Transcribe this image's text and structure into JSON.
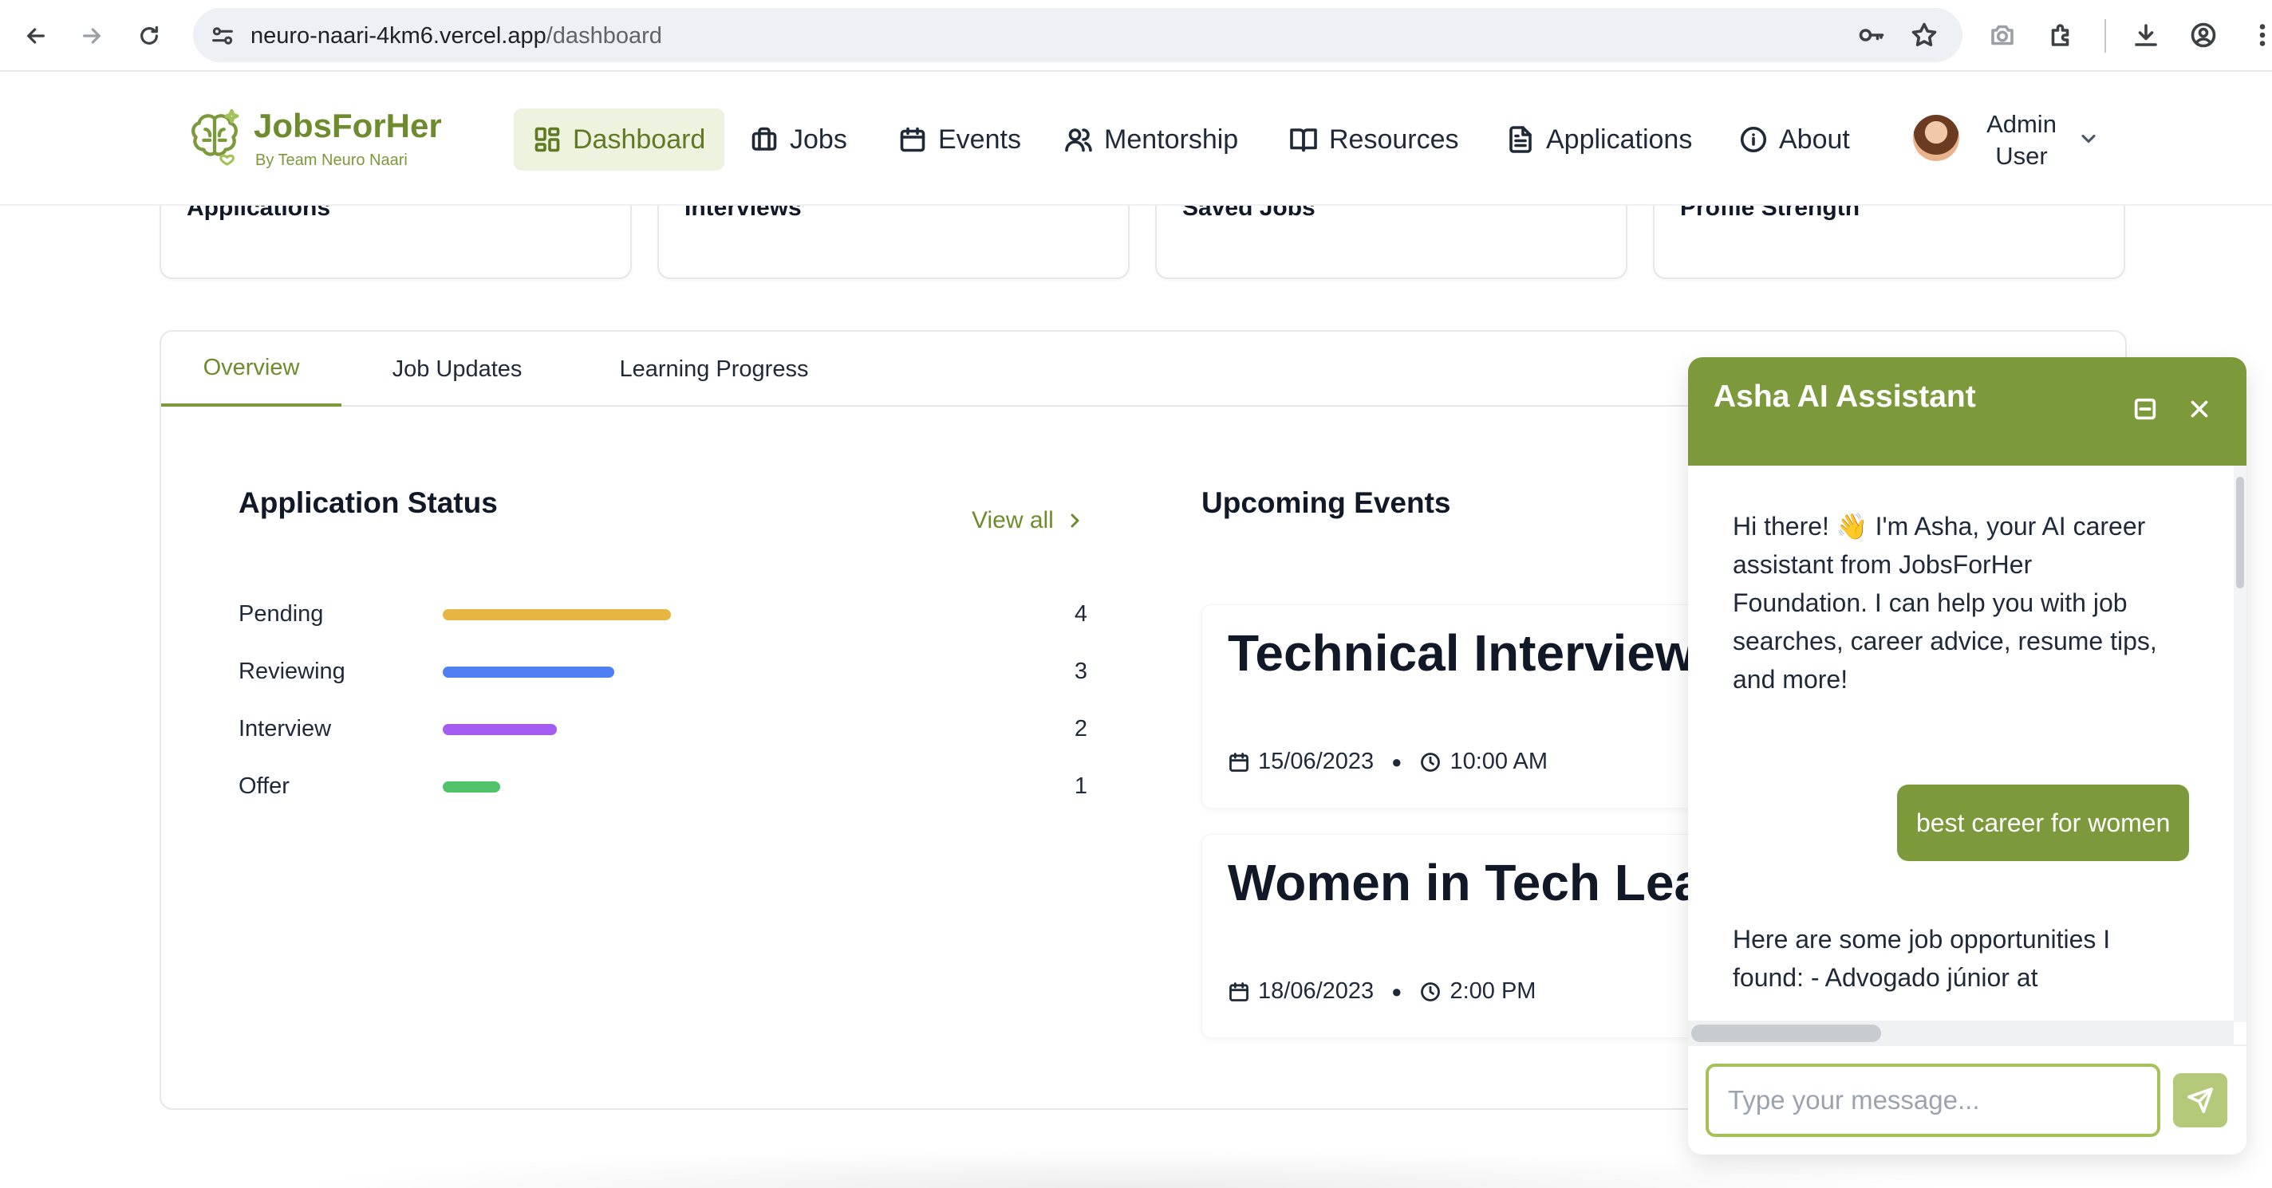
{
  "browser": {
    "url_host": "neuro-naari-4km6.vercel.app",
    "url_path": "/dashboard"
  },
  "brand": {
    "title": "JobsForHer",
    "subtitle": "By Team Neuro Naari",
    "accent_color": "#7c9a3c"
  },
  "nav": {
    "items": [
      {
        "label": "Dashboard",
        "icon": "dashboard-icon",
        "active": true
      },
      {
        "label": "Jobs",
        "icon": "briefcase-icon"
      },
      {
        "label": "Events",
        "icon": "calendar-icon"
      },
      {
        "label": "Mentorship",
        "icon": "users-icon"
      },
      {
        "label": "Resources",
        "icon": "book-icon"
      },
      {
        "label": "Applications",
        "icon": "document-icon"
      },
      {
        "label": "About",
        "icon": "info-icon"
      }
    ],
    "user": {
      "name_line1": "Admin",
      "name_line2": "User"
    }
  },
  "stats": [
    {
      "label": "Applications"
    },
    {
      "label": "Interviews"
    },
    {
      "label": "Saved Jobs"
    },
    {
      "label": "Profile Strength"
    }
  ],
  "tabs": [
    {
      "label": "Overview",
      "active": true
    },
    {
      "label": "Job Updates"
    },
    {
      "label": "Learning Progress"
    }
  ],
  "application_status": {
    "title": "Application Status",
    "view_all": "View all",
    "rows": [
      {
        "label": "Pending",
        "count": 4,
        "color": "#e7b541"
      },
      {
        "label": "Reviewing",
        "count": 3,
        "color": "#4f7ff0"
      },
      {
        "label": "Interview",
        "count": 2,
        "color": "#a45cf0"
      },
      {
        "label": "Offer",
        "count": 1,
        "color": "#4fc26a"
      }
    ]
  },
  "upcoming_events": {
    "title": "Upcoming Events",
    "events": [
      {
        "title": "Technical Interview Preparation",
        "date": "15/06/2023",
        "time": "10:00 AM"
      },
      {
        "title": "Women in Tech Leadership Panel",
        "date": "18/06/2023",
        "time": "2:00 PM"
      }
    ]
  },
  "chat": {
    "title": "Asha AI Assistant",
    "messages": [
      {
        "from": "bot",
        "text": "Hi there! 👋 I'm Asha, your AI career assistant from JobsForHer Foundation. I can help you with job searches, career advice, resume tips, and more!"
      },
      {
        "from": "user",
        "text": "best career for women"
      },
      {
        "from": "bot",
        "text": "Here are some job opportunities I found: - Advogado júnior at"
      }
    ],
    "input_placeholder": "Type your message..."
  }
}
